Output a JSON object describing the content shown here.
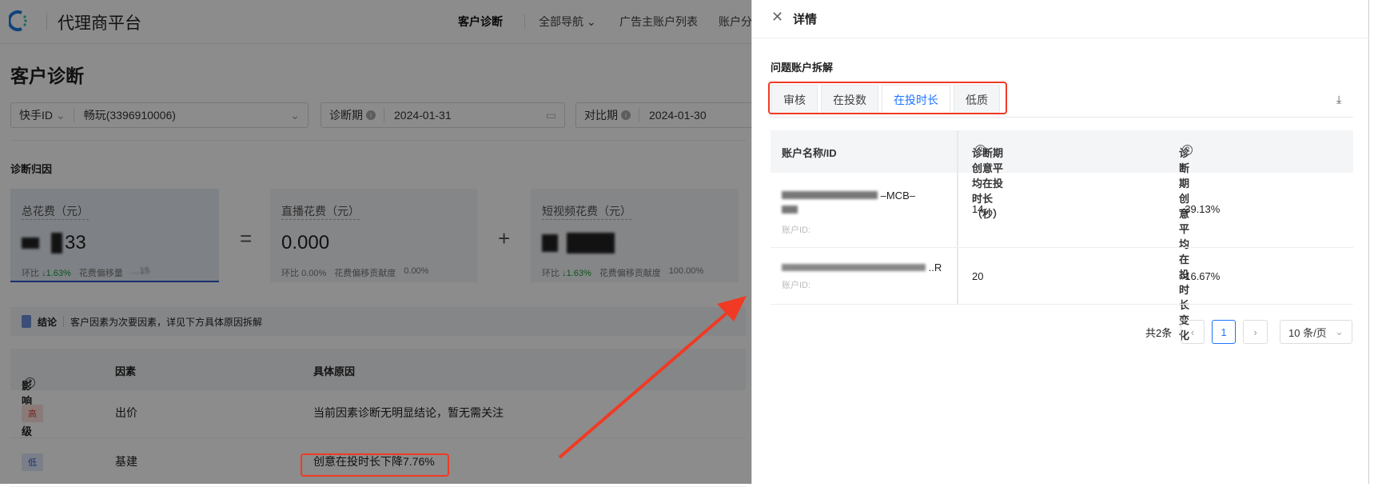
{
  "header": {
    "brand": "代理商平台",
    "nav": [
      "客户诊断",
      "全部导航",
      "广告主账户列表",
      "账户分"
    ]
  },
  "page": {
    "title": "客户诊断"
  },
  "filters": {
    "id_type": "快手ID",
    "account": "畅玩(3396910006)",
    "diag_label": "诊断期",
    "diag_date": "2024-01-31",
    "cmp_label": "对比期",
    "cmp_date": "2024-01-30"
  },
  "attribution": {
    "section": "诊断归因",
    "cards": [
      {
        "title": "总花费（元）",
        "value_tail": "33",
        "ratio_label": "环比",
        "ratio": "↓1.63%",
        "extra_label": "花费偏移量",
        "extra_value": "…15"
      },
      {
        "title": "直播花费（元）",
        "value": "0.000",
        "ratio_label": "环比",
        "ratio": "0.00%",
        "extra_label": "花费偏移贡献度",
        "extra_value": "0.00%"
      },
      {
        "title": "短视频花费（元）",
        "ratio_label": "环比",
        "ratio": "↓1.63%",
        "extra_label": "花费偏移贡献度",
        "extra_value": "100.00%"
      }
    ],
    "ops": [
      "=",
      "+"
    ]
  },
  "conclusion": {
    "label": "结论",
    "text": "客户因素为次要因素，详见下方具体原因拆解"
  },
  "factors": {
    "headers": [
      "影响等级",
      "因素",
      "具体原因"
    ],
    "rows": [
      {
        "level": "高",
        "factor": "出价",
        "reason": "当前因素诊断无明显结论，暂无需关注"
      },
      {
        "level": "低",
        "factor": "基建",
        "reason": "创意在投时长下降7.76%"
      }
    ]
  },
  "drawer": {
    "title": "详情",
    "subtitle": "问题账户拆解",
    "tabs": [
      "审核",
      "在投数",
      "在投时长",
      "低质"
    ],
    "active_tab": "在投时长",
    "table": {
      "headers": [
        "账户名称/ID",
        "诊断期创意平均在投时长（秒）",
        "诊断期创意平均在投时长变化"
      ],
      "rows": [
        {
          "name_visible": "–MCB–",
          "id_label": "账户ID:",
          "duration": "14",
          "change": "–39.13%"
        },
        {
          "name_visible": "..R",
          "id_label": "账户ID:",
          "duration": "20",
          "change": "–16.67%"
        }
      ]
    },
    "pagination": {
      "total": "共2条",
      "current": "1",
      "page_size": "10 条/页"
    }
  },
  "colors": {
    "accent": "#1e74ff",
    "annotation": "#f03a24"
  }
}
